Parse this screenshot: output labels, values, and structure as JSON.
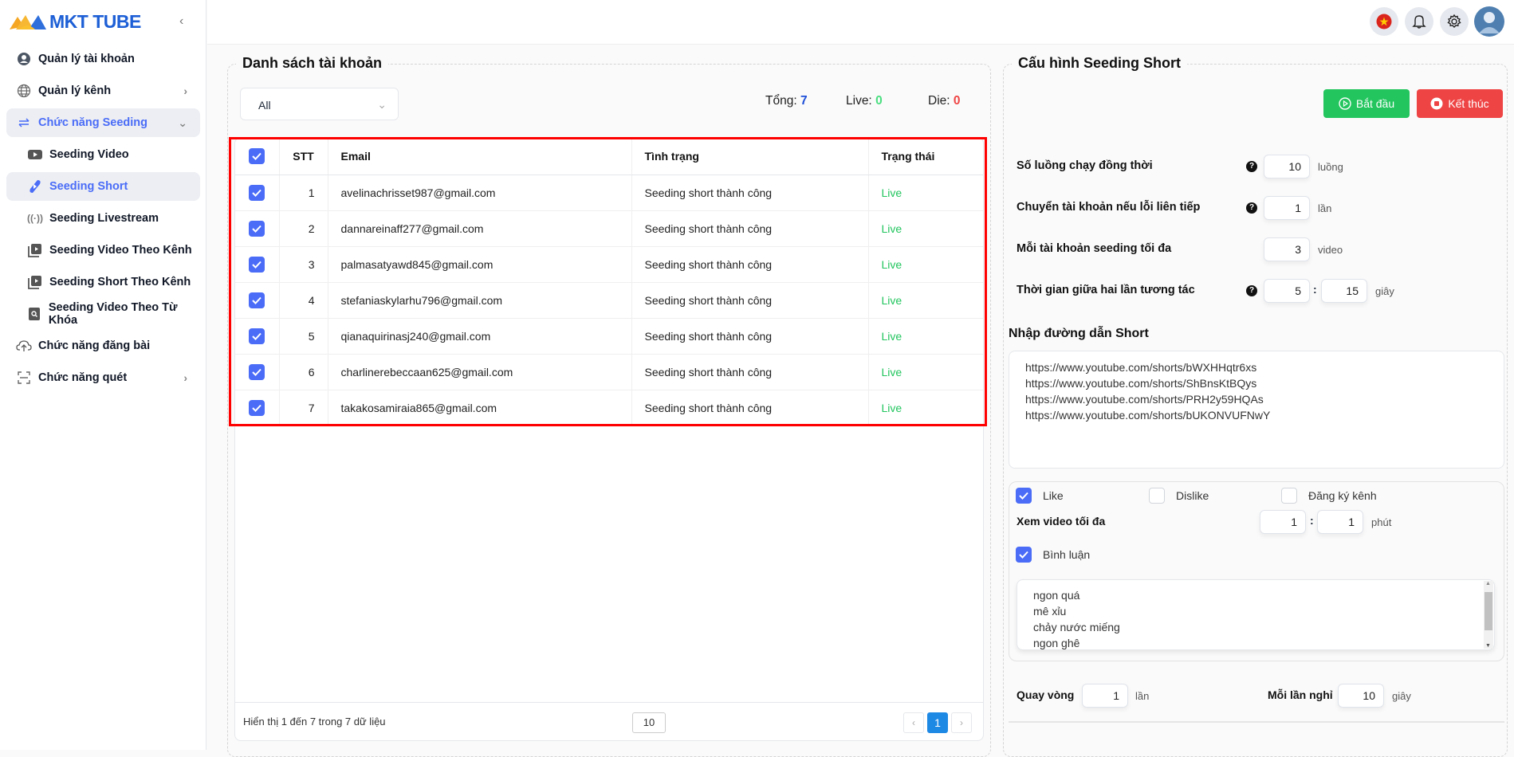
{
  "app": {
    "name": "MKT TUBE"
  },
  "sidebar": {
    "items": [
      {
        "label": "Quản lý tài khoản",
        "icon": "user-circle-icon"
      },
      {
        "label": "Quản lý kênh",
        "icon": "globe-icon"
      },
      {
        "label": "Chức năng Seeding",
        "icon": "swap-arrows-icon",
        "open": true
      },
      {
        "label": "Seeding Video",
        "icon": "youtube-icon"
      },
      {
        "label": "Seeding Short",
        "icon": "shorts-icon",
        "active": true
      },
      {
        "label": "Seeding Livestream",
        "icon": "broadcast-icon"
      },
      {
        "label": "Seeding Video Theo Kênh",
        "icon": "playlist-icon"
      },
      {
        "label": "Seeding Short Theo Kênh",
        "icon": "playlist-icon"
      },
      {
        "label": "Seeding Video Theo Từ Khóa",
        "icon": "search-file-icon"
      },
      {
        "label": "Chức năng đăng bài",
        "icon": "cloud-upload-icon"
      },
      {
        "label": "Chức năng quét",
        "icon": "scan-icon"
      }
    ]
  },
  "header": {
    "icons": [
      "vietnam-flag-icon",
      "bell-icon",
      "gear-icon",
      "avatar"
    ]
  },
  "accounts": {
    "title": "Danh sách tài khoản",
    "filter": "All",
    "stats": {
      "total_label": "Tổng:",
      "total": "7",
      "live_label": "Live:",
      "live": "0",
      "die_label": "Die:",
      "die": "0"
    },
    "columns": [
      "STT",
      "Email",
      "Tình trạng",
      "Trạng thái"
    ],
    "rows": [
      {
        "stt": "1",
        "email": "avelinachrisset987@gmail.com",
        "status": "Seeding short thành công",
        "state": "Live"
      },
      {
        "stt": "2",
        "email": "dannareinaff277@gmail.com",
        "status": "Seeding short thành công",
        "state": "Live"
      },
      {
        "stt": "3",
        "email": "palmasatyawd845@gmail.com",
        "status": "Seeding short thành công",
        "state": "Live"
      },
      {
        "stt": "4",
        "email": "stefaniaskylarhu796@gmail.com",
        "status": "Seeding short thành công",
        "state": "Live"
      },
      {
        "stt": "5",
        "email": "qianaquirinasj240@gmail.com",
        "status": "Seeding short thành công",
        "state": "Live"
      },
      {
        "stt": "6",
        "email": "charlinerebeccaan625@gmail.com",
        "status": "Seeding short thành công",
        "state": "Live"
      },
      {
        "stt": "7",
        "email": "takakosamiraia865@gmail.com",
        "status": "Seeding short thành công",
        "state": "Live"
      }
    ],
    "footer": {
      "summary": "Hiển thị 1 đến 7 trong 7 dữ liệu",
      "page_size": "10",
      "prev": "‹",
      "current_page": "1",
      "next": "›"
    }
  },
  "config": {
    "title": "Cấu hình Seeding Short",
    "start_label": "Bắt đầu",
    "stop_label": "Kết thúc",
    "threads": {
      "label": "Số luồng chạy đồng thời",
      "value": "10",
      "unit": "luồng"
    },
    "switch_on_error": {
      "label": "Chuyển tài khoản nếu lỗi liên tiếp",
      "value": "1",
      "unit": "lần"
    },
    "max_per_account": {
      "label": "Mỗi tài khoản seeding tối đa",
      "value": "3",
      "unit": "video"
    },
    "interval": {
      "label": "Thời gian giữa hai lần tương tác",
      "min": "5",
      "max": "15",
      "unit": "giây"
    },
    "links_label": "Nhập đường dẫn Short",
    "links": "https://www.youtube.com/shorts/bWXHHqtr6xs\nhttps://www.youtube.com/shorts/ShBnsKtBQys\nhttps://www.youtube.com/shorts/PRH2y59HQAs\nhttps://www.youtube.com/shorts/bUKONVUFNwY",
    "like": {
      "label": "Like",
      "checked": true
    },
    "dislike": {
      "label": "Dislike",
      "checked": false
    },
    "subscribe": {
      "label": "Đăng ký kênh",
      "checked": false
    },
    "watch": {
      "label": "Xem video tối đa",
      "min": "1",
      "max": "1",
      "unit": "phút"
    },
    "comment": {
      "label": "Bình luận",
      "checked": true
    },
    "comments": "ngon quá\nmê xỉu\nchảy nước miếng\nngon ghê",
    "loop": {
      "label": "Quay vòng",
      "value": "1",
      "unit": "lần"
    },
    "rest": {
      "label": "Mỗi lần nghỉ",
      "value": "10",
      "unit": "giây"
    }
  },
  "colors": {
    "accent": "#4a6cf7",
    "live": "#22c55e",
    "die": "#ef4444",
    "total": "#1d4ed8",
    "start": "#22c55e",
    "stop": "#ef4444",
    "highlight": "#ff0000"
  }
}
